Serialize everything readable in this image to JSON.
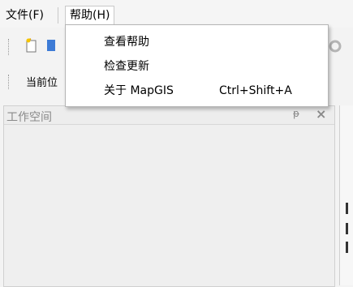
{
  "menubar": {
    "file": "文件(F)",
    "help": "帮助(H)"
  },
  "toolbar": {
    "current_label": "当前位"
  },
  "workspace": {
    "title": "工作空间",
    "pin": "ᵽ",
    "close": "×"
  },
  "help_menu": {
    "items": [
      {
        "label": "查看帮助",
        "shortcut": ""
      },
      {
        "label": "检查更新",
        "shortcut": ""
      },
      {
        "label": "关于 MapGIS",
        "shortcut": "Ctrl+Shift+A"
      }
    ]
  },
  "colors": {
    "menu_bg": "#ffffff",
    "window_bg": "#f3f3f3",
    "border": "#b5b5b5"
  }
}
